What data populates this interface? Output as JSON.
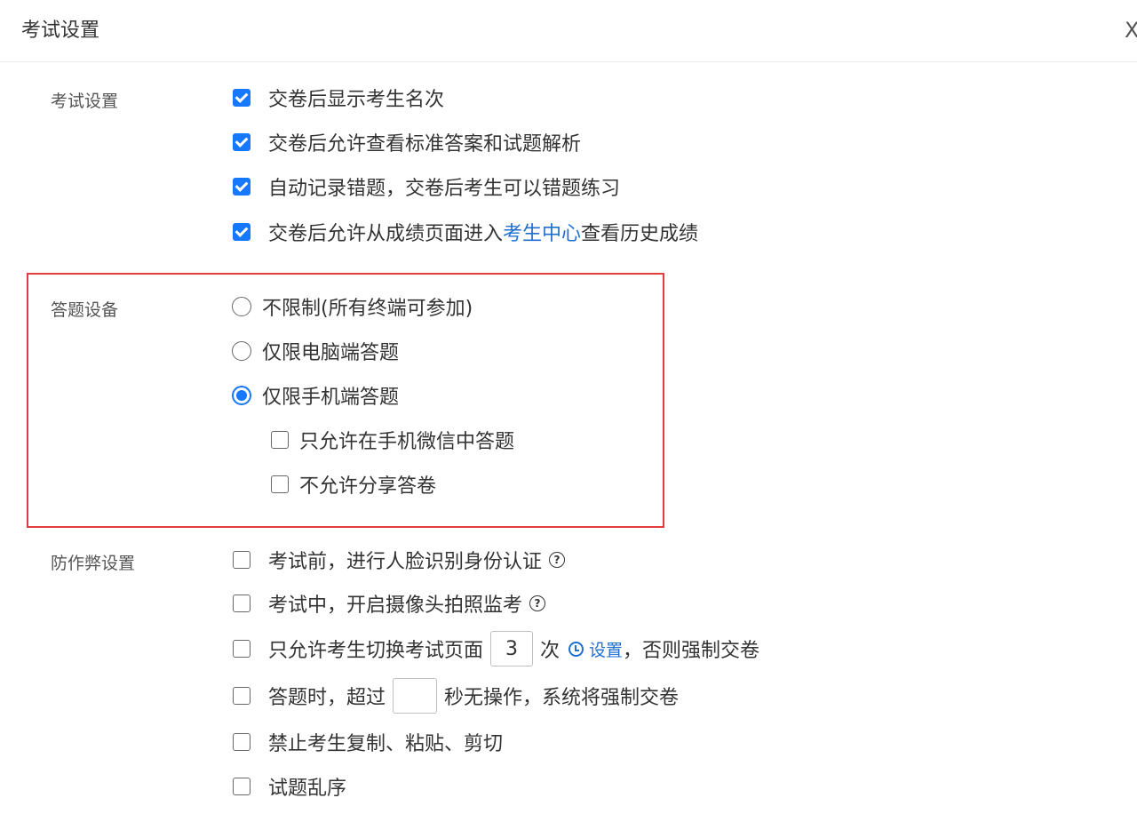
{
  "header": {
    "title": "考试设置",
    "close_label": "X"
  },
  "sections": {
    "exam": {
      "label": "考试设置",
      "items": [
        {
          "text": "交卷后显示考生名次",
          "checked": true
        },
        {
          "text": "交卷后允许查看标准答案和试题解析",
          "checked": true
        },
        {
          "text": "自动记录错题，交卷后考生可以错题练习",
          "checked": true
        },
        {
          "text_before": "交卷后允许从成绩页面进入",
          "link": "考生中心",
          "text_after": "查看历史成绩",
          "checked": true
        }
      ]
    },
    "device": {
      "label": "答题设备",
      "options": [
        {
          "text": "不限制(所有终端可参加)",
          "selected": false
        },
        {
          "text": "仅限电脑端答题",
          "selected": false
        },
        {
          "text": "仅限手机端答题",
          "selected": true
        }
      ],
      "sub_options": [
        {
          "text": "只允许在手机微信中答题",
          "checked": false
        },
        {
          "text": "不允许分享答卷",
          "checked": false
        }
      ]
    },
    "anti_cheat": {
      "label": "防作弊设置",
      "face": "考试前，进行人脸识别身份认证",
      "camera": "考试中，开启摄像头拍照监考",
      "switch_before": "只允许考生切换考试页面",
      "switch_count": "3",
      "switch_unit": "次",
      "switch_setting": "设置",
      "switch_after": "，否则强制交卷",
      "idle_before": "答题时，超过",
      "idle_value": "",
      "idle_after": "秒无操作，系统将强制交卷",
      "no_copy": "禁止考生复制、粘贴、剪切",
      "shuffle": "试题乱序",
      "help_glyph": "?"
    }
  },
  "colors": {
    "accent": "#1677ff",
    "link": "#1f6fd1",
    "highlight": "#e23c3c"
  }
}
